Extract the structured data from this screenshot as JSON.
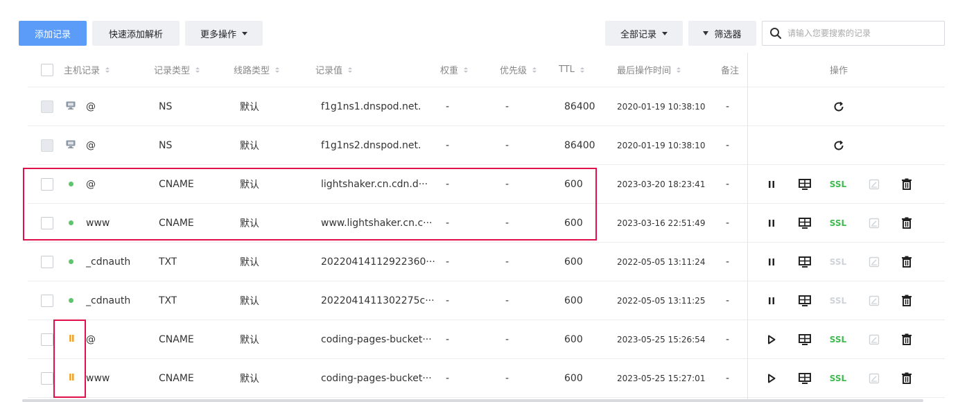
{
  "toolbar": {
    "add_record": "添加记录",
    "quick_add": "快速添加解析",
    "more_actions": "更多操作",
    "all_records": "全部记录",
    "filter": "筛选器",
    "search_placeholder": "请输入您要搜索的记录"
  },
  "table": {
    "headers": {
      "host": "主机记录",
      "type": "记录类型",
      "line": "线路类型",
      "value": "记录值",
      "weight": "权重",
      "priority": "优先级",
      "ttl": "TTL",
      "updated": "最后操作时间",
      "remark": "备注",
      "actions": "操作"
    },
    "rows": [
      {
        "host": "@",
        "type": "NS",
        "line": "默认",
        "value": "f1g1ns1.dnspod.net.",
        "weight": "-",
        "priority": "-",
        "ttl": "86400",
        "updated": "2020-01-19 10:38:10",
        "remark": "-",
        "status": "system"
      },
      {
        "host": "@",
        "type": "NS",
        "line": "默认",
        "value": "f1g1ns2.dnspod.net.",
        "weight": "-",
        "priority": "-",
        "ttl": "86400",
        "updated": "2020-01-19 10:38:10",
        "remark": "-",
        "status": "system"
      },
      {
        "host": "@",
        "type": "CNAME",
        "line": "默认",
        "value": "lightshaker.cn.cdn.d···",
        "weight": "-",
        "priority": "-",
        "ttl": "600",
        "updated": "2023-03-20 18:23:41",
        "remark": "-",
        "status": "enabled",
        "ssl": "SSL"
      },
      {
        "host": "www",
        "type": "CNAME",
        "line": "默认",
        "value": "www.lightshaker.cn.c···",
        "weight": "-",
        "priority": "-",
        "ttl": "600",
        "updated": "2023-03-16 22:51:49",
        "remark": "-",
        "status": "enabled",
        "ssl": "SSL"
      },
      {
        "host": "_cdnauth",
        "type": "TXT",
        "line": "默认",
        "value": "20220414112922360···",
        "weight": "-",
        "priority": "-",
        "ttl": "600",
        "updated": "2022-05-05 13:11:24",
        "remark": "-",
        "status": "enabled",
        "ssl": "SSL"
      },
      {
        "host": "_cdnauth",
        "type": "TXT",
        "line": "默认",
        "value": "2022041411302275c···",
        "weight": "-",
        "priority": "-",
        "ttl": "600",
        "updated": "2022-05-05 13:11:25",
        "remark": "-",
        "status": "enabled",
        "ssl": "SSL"
      },
      {
        "host": "@",
        "type": "CNAME",
        "line": "默认",
        "value": "coding-pages-bucket···",
        "weight": "-",
        "priority": "-",
        "ttl": "600",
        "updated": "2023-05-25 15:26:54",
        "remark": "-",
        "status": "paused",
        "ssl": "SSL"
      },
      {
        "host": "www",
        "type": "CNAME",
        "line": "默认",
        "value": "coding-pages-bucket···",
        "weight": "-",
        "priority": "-",
        "ttl": "600",
        "updated": "2023-05-25 15:27:01",
        "remark": "-",
        "status": "paused",
        "ssl": "SSL"
      }
    ]
  },
  "colors": {
    "primary": "#5b9cf8",
    "highlight": "#e0104a",
    "enabled_dot": "#5ec56c",
    "paused": "#f0a025",
    "ssl_on": "#3fb950"
  }
}
